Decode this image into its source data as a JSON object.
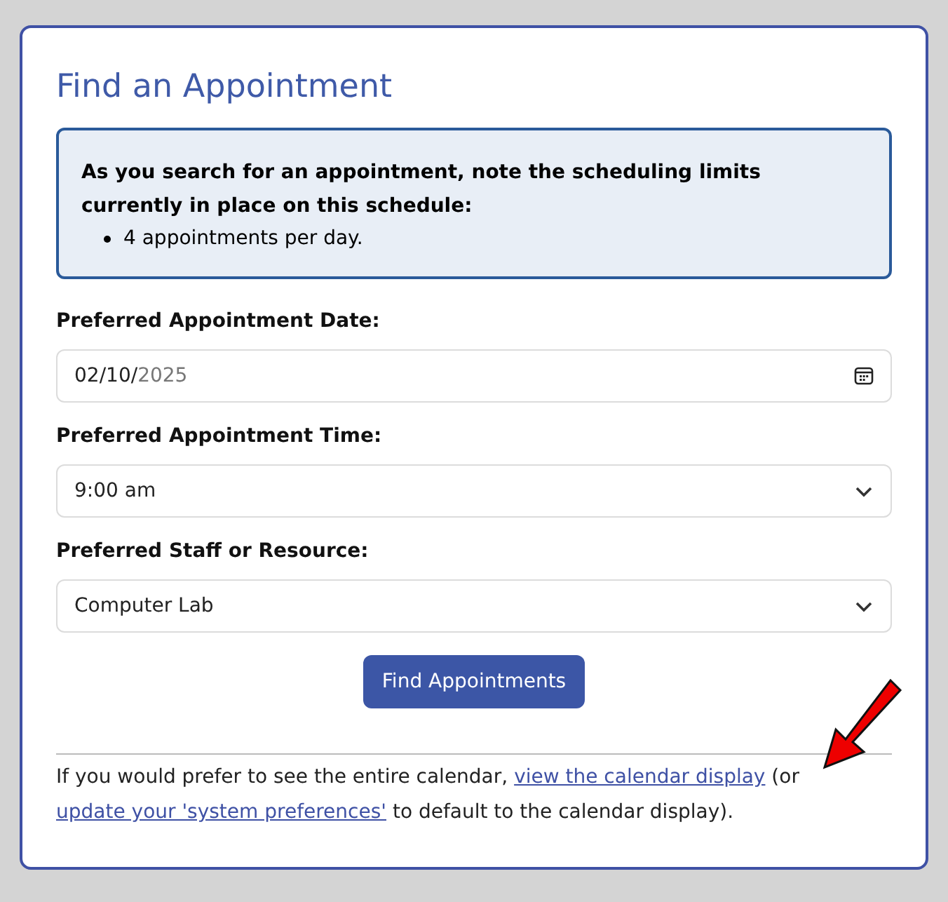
{
  "title": "Find an Appointment",
  "notice": {
    "heading": "As you search for an appointment, note the scheduling limits currently in place on this schedule:",
    "items": [
      "4 appointments per day."
    ]
  },
  "fields": [
    {
      "kind": "date",
      "label": "Preferred Appointment Date:",
      "value": "02/10/",
      "value_dim": "2025"
    },
    {
      "kind": "select",
      "label": "Preferred Appointment Time:",
      "value": "9:00 am"
    },
    {
      "kind": "select",
      "label": "Preferred Staff or Resource:",
      "value": "Computer Lab"
    }
  ],
  "button": "Find Appointments",
  "footer": [
    {
      "kind": "text",
      "text": "If you would prefer to see the entire calendar,"
    },
    {
      "kind": "link",
      "text": "view the calendar display"
    },
    {
      "kind": "text",
      "text": "(or"
    },
    {
      "kind": "link",
      "text": "update your 'system preferences'"
    },
    {
      "kind": "text",
      "text": "to default to the calendar display)."
    }
  ]
}
